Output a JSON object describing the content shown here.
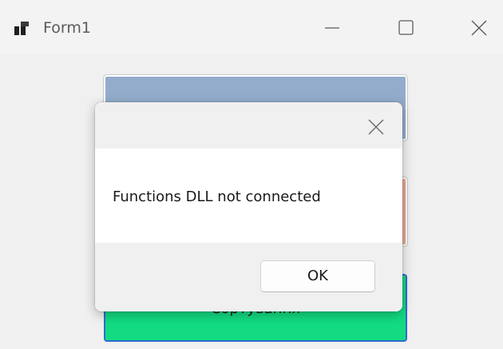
{
  "window": {
    "title": "Form1",
    "icon": "app-form-icon"
  },
  "caption_buttons": {
    "minimize_icon": "minimize-icon",
    "maximize_icon": "maximize-icon",
    "close_icon": "close-icon"
  },
  "form": {
    "buttons": [
      {
        "label": "",
        "color": "#93accb"
      },
      {
        "label": "",
        "color": "#e6a98e"
      },
      {
        "label": "Сортування",
        "color": "#12db82",
        "focus_border": "#2f6bd0"
      }
    ]
  },
  "dialog": {
    "message": "Functions DLL not connected",
    "ok_label": "OK",
    "close_icon": "close-icon"
  }
}
